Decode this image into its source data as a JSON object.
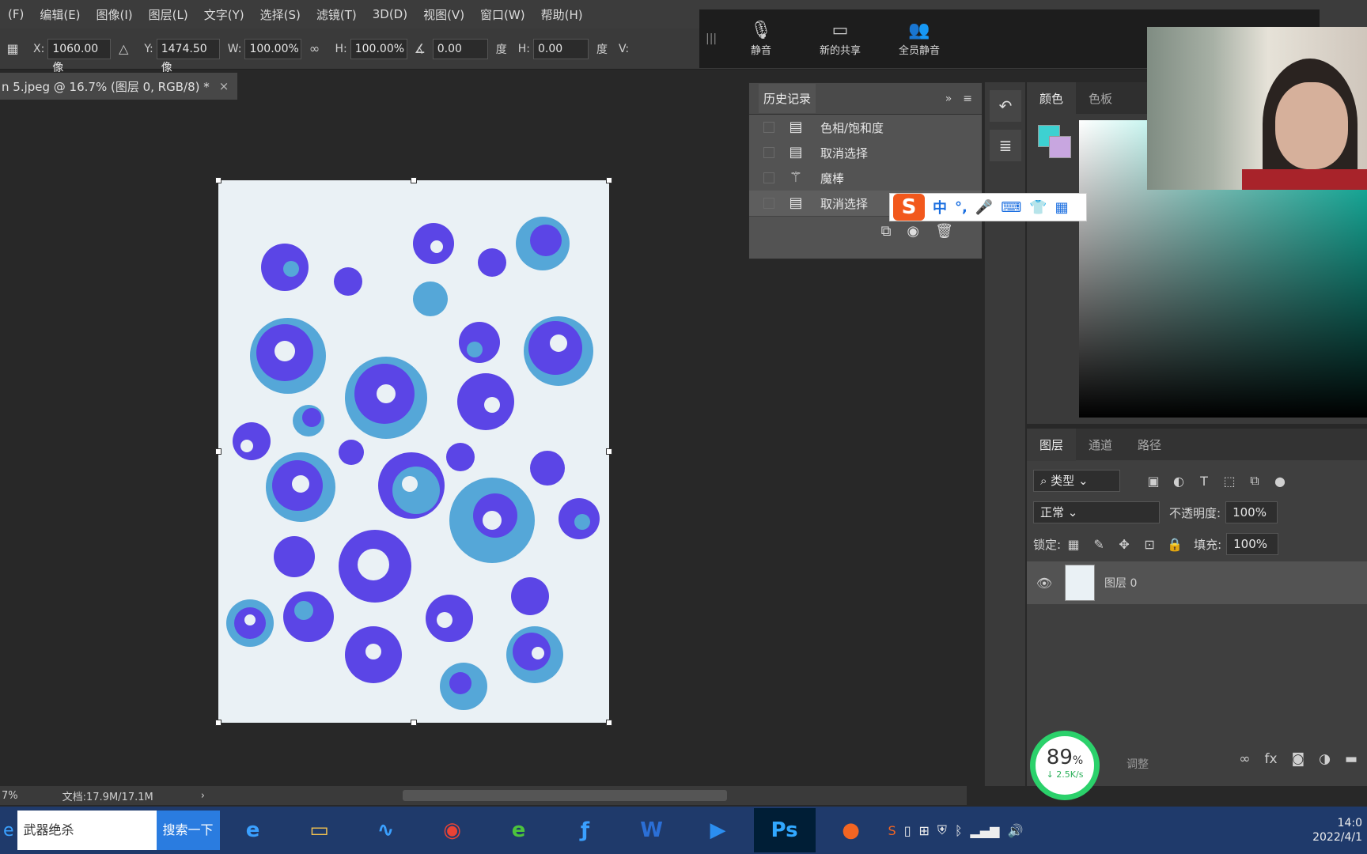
{
  "menu": [
    "(F)",
    "编辑(E)",
    "图像(I)",
    "图层(L)",
    "文字(Y)",
    "选择(S)",
    "滤镜(T)",
    "3D(D)",
    "视图(V)",
    "窗口(W)",
    "帮助(H)"
  ],
  "options": {
    "x_label": "X:",
    "x_value": "1060.00 像",
    "y_label": "Y:",
    "y_value": "1474.50 像",
    "w_label": "W:",
    "w_value": "100.00%",
    "h_label": "H:",
    "h_value": "100.00%",
    "angle_value": "0.00",
    "angle_unit": "度",
    "hskew_label": "H:",
    "hskew_value": "0.00",
    "hskew_unit": "度",
    "v_label": "V:"
  },
  "meeting": {
    "mute": "静音",
    "share": "新的共享",
    "mute_all": "全员静音"
  },
  "tab": {
    "title": "n 5.jpeg @ 16.7% (图层 0, RGB/8) *",
    "close": "×"
  },
  "history": {
    "title": "历史记录",
    "items": [
      "色相/饱和度",
      "取消选择",
      "魔棒",
      "取消选择"
    ]
  },
  "color_panel": {
    "tab1": "颜色",
    "tab2": "色板",
    "fg_color": "#3dd1d1",
    "bg_color": "#c8a6e0"
  },
  "layers_panel": {
    "tab1": "图层",
    "tab2": "通道",
    "tab3": "路径",
    "filter": "类型",
    "blend_mode": "正常",
    "opacity_label": "不透明度:",
    "opacity_value": "100%",
    "lock_label": "锁定:",
    "fill_label": "填充:",
    "fill_value": "100%",
    "layer_name": "图层 0",
    "adjust_label": "调整"
  },
  "speed": {
    "percent": "89",
    "unit": "%",
    "rate": "↓ 2.5K/s"
  },
  "status": {
    "zoom": "7%",
    "doc": "文档:17.9M/17.1M"
  },
  "ime": {
    "mode": "中"
  },
  "taskbar": {
    "search_text": "武器绝杀",
    "search_button": "搜索一下",
    "clock_time": "14:0",
    "clock_date": "2022/4/1"
  }
}
